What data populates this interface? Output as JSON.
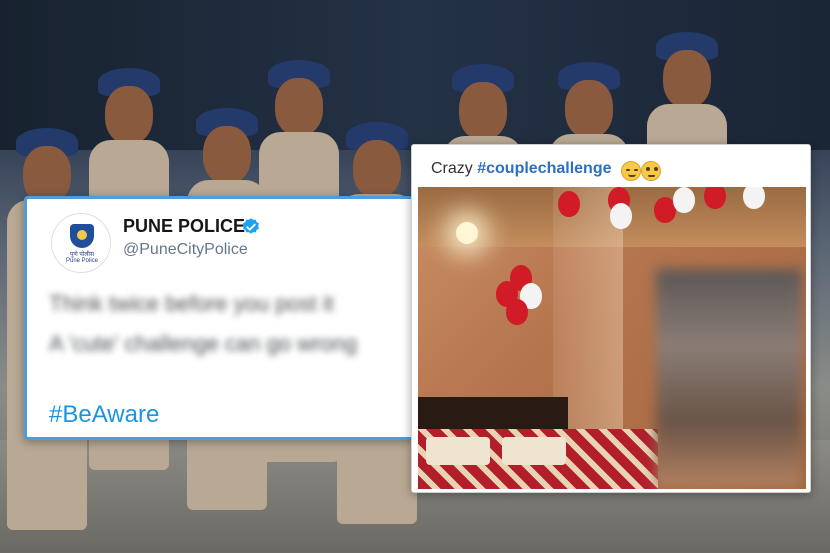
{
  "tweet": {
    "display_name": "PUNE POLICE",
    "handle": "@PuneCityPolice",
    "avatar_text_1": "पुणे पोलीस",
    "avatar_text_2": "Pune Police",
    "body_line_1": "Think twice before you post it",
    "body_line_2": "A 'cute' challenge can go wrong",
    "hashtag": "#BeAware",
    "verified_color": "#1da1f2",
    "hashtag_color": "#1b95e0"
  },
  "post": {
    "title_prefix": "Crazy ",
    "title_hashtag": "#couplechallenge",
    "emojis": [
      "smiling-face-icon",
      "rolling-eyes-face-icon"
    ]
  },
  "colors": {
    "card_border": "#4b9de0",
    "background_uniform": "#b9a994",
    "cap": "#233a6a"
  }
}
